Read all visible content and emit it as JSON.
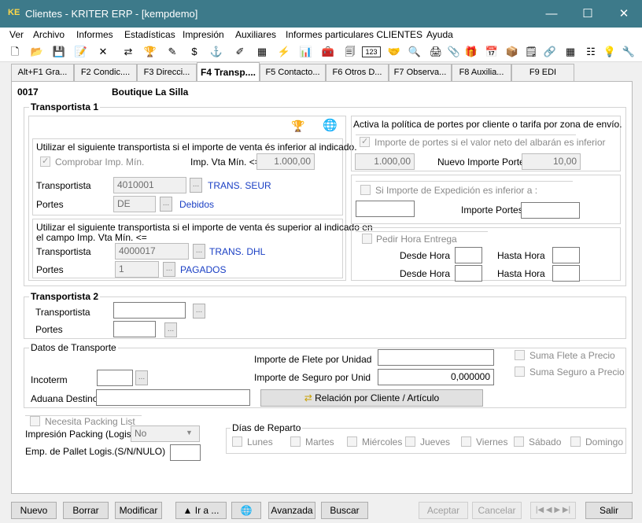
{
  "window": {
    "title": "Clientes - KRITER ERP - [kempdemo]",
    "app_icon": "KE",
    "min": "—",
    "max": "☐",
    "close": "✕"
  },
  "menu": [
    "Ver",
    "Archivo",
    "Informes",
    "Estadísticas",
    "Impresión",
    "Auxiliares",
    "Informes particulares CLIENTES",
    "Ayuda"
  ],
  "toolbar": [
    "🗋",
    "📂",
    "💾",
    "📝",
    "✕",
    "⇄",
    "🏆",
    "✎",
    "$",
    "⚓",
    "✐",
    "▦",
    "⚡",
    "📊",
    "🧰",
    "🗐",
    "123",
    "🤝",
    "🔍",
    "🖨",
    "📎",
    "🎁",
    "📅",
    "📦",
    "🗒",
    "🔗",
    "▦",
    "☷",
    "💡",
    "🔧"
  ],
  "tabs": [
    "Alt+F1 Gra...",
    "F2 Condic....",
    "F3 Direcci...",
    "F4 Transp....",
    "F5 Contacto...",
    "F6 Otros D...",
    "F7 Observa...",
    "F8 Auxilia...",
    "F9 EDI"
  ],
  "client": {
    "code": "0017",
    "name": "Boutique La Silla"
  },
  "t1": {
    "title": "Transportista 1",
    "icons": {
      "a": "🏆",
      "b": "🌐"
    },
    "inf_desc": "Utilizar el siguiente transportista si el importe de venta és inferior al indicado.",
    "comprobar": "Comprobar Imp. Mín.",
    "imp_vta_label": "Imp. Vta Mín. <=",
    "imp_vta_value": "1.000,00",
    "transportista_label": "Transportista",
    "transp1_code": "4010001",
    "transp1_name": "TRANS. SEUR",
    "portes_label": "Portes",
    "portes1_code": "DE",
    "portes1_name": "Debidos",
    "sup_desc1": "Utilizar el siguiente transportista si el importe de venta és superior al indicado en",
    "sup_desc2": "el campo Imp. Vta Mín. <=",
    "transp2_code": "4000017",
    "transp2_name": "TRANS. DHL",
    "portes2_code": "1",
    "portes2_name": "PAGADOS",
    "politica": "Activa la política de portes por cliente o tarifa por zona de envío.",
    "imp_portes_chk": "Importe de portes si el valor neto del albarán es inferior",
    "imp_portes_value": "1.000,00",
    "nuevo_imp_label": "Nuevo Importe Portes",
    "nuevo_imp_value": "10,00",
    "si_imp_chk": "Si Importe de Expedición es inferior a :",
    "importe_portes_label": "Importe Portes :",
    "pedir_hora": "Pedir Hora Entrega",
    "desde_hora": "Desde Hora",
    "hasta_hora": "Hasta Hora"
  },
  "t2": {
    "title": "Transportista 2",
    "transportista_label": "Transportista",
    "portes_label": "Portes"
  },
  "datos": {
    "title": "Datos de Transporte",
    "flete_label": "Importe de Flete por Unidad",
    "seguro_label": "Importe de Seguro por Unid",
    "seguro_value": "0,000000",
    "suma_flete": "Suma Flete a Precio",
    "suma_seguro": "Suma Seguro a Precio",
    "incoterm": "Incoterm",
    "aduana": "Aduana Destino",
    "relacion_btn": "Relación por Cliente / Artículo",
    "dots": "..."
  },
  "packing": {
    "necesita": "Necesita Packing List",
    "impresion_label": "Impresión Packing (Logis.)",
    "impresion_value": "No",
    "emp_pallet": "Emp. de Pallet Logis.(S/N/NULO)"
  },
  "reparto": {
    "title": "Días de Reparto",
    "days": [
      "Lunes",
      "Martes",
      "Miércoles",
      "Jueves",
      "Viernes",
      "Sábado",
      "Domingo"
    ]
  },
  "buttons": {
    "nuevo": "Nuevo",
    "borrar": "Borrar",
    "modificar": "Modificar",
    "ira": "▲ Ir a ...",
    "globe": "🌐",
    "avanzada": "Avanzada",
    "buscar": "Buscar",
    "aceptar": "Aceptar",
    "cancelar": "Cancelar",
    "nav": "|◀ ◀ ▶ ▶|",
    "salir": "Salir"
  }
}
